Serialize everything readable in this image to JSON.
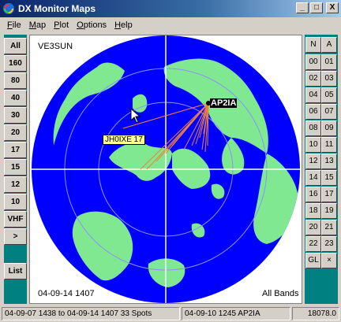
{
  "window": {
    "title": "DX Monitor Maps",
    "minimize": "_",
    "maximize": "□",
    "close": "X"
  },
  "menu": [
    {
      "label": "File",
      "ul": "F",
      "rest": "ile"
    },
    {
      "label": "Map",
      "ul": "M",
      "rest": "ap"
    },
    {
      "label": "Plot",
      "ul": "P",
      "rest": "lot"
    },
    {
      "label": "Options",
      "ul": "O",
      "rest": "ptions"
    },
    {
      "label": "Help",
      "ul": "H",
      "rest": "elp"
    }
  ],
  "bands": [
    "All",
    "160",
    "80",
    "40",
    "30",
    "20",
    "17",
    "15",
    "12",
    "10",
    "VHF",
    ">"
  ],
  "list_button": "List",
  "right_header": [
    "N",
    "A"
  ],
  "hours": [
    "00",
    "01",
    "02",
    "03",
    "04",
    "05",
    "06",
    "07",
    "08",
    "09",
    "10",
    "11",
    "12",
    "13",
    "14",
    "15",
    "16",
    "17",
    "18",
    "19",
    "20",
    "21",
    "22",
    "23"
  ],
  "right_footer": [
    "GL",
    "×"
  ],
  "map": {
    "callsign": "VE3SUN",
    "target_label": "AP2IA",
    "spot_label": "JH0IXE 17",
    "date": "04-09-14 1407",
    "bands_label": "All Bands"
  },
  "status": {
    "range": "04-09-07 1438 to 04-09-14 1407 33 Spots",
    "last_spot": "04-09-10 1245 AP2IA",
    "freq": "18078.0"
  },
  "colors": {
    "ocean": "#0000ff",
    "land": "#7fe890",
    "teal": "#008080",
    "path": "#f08040"
  }
}
